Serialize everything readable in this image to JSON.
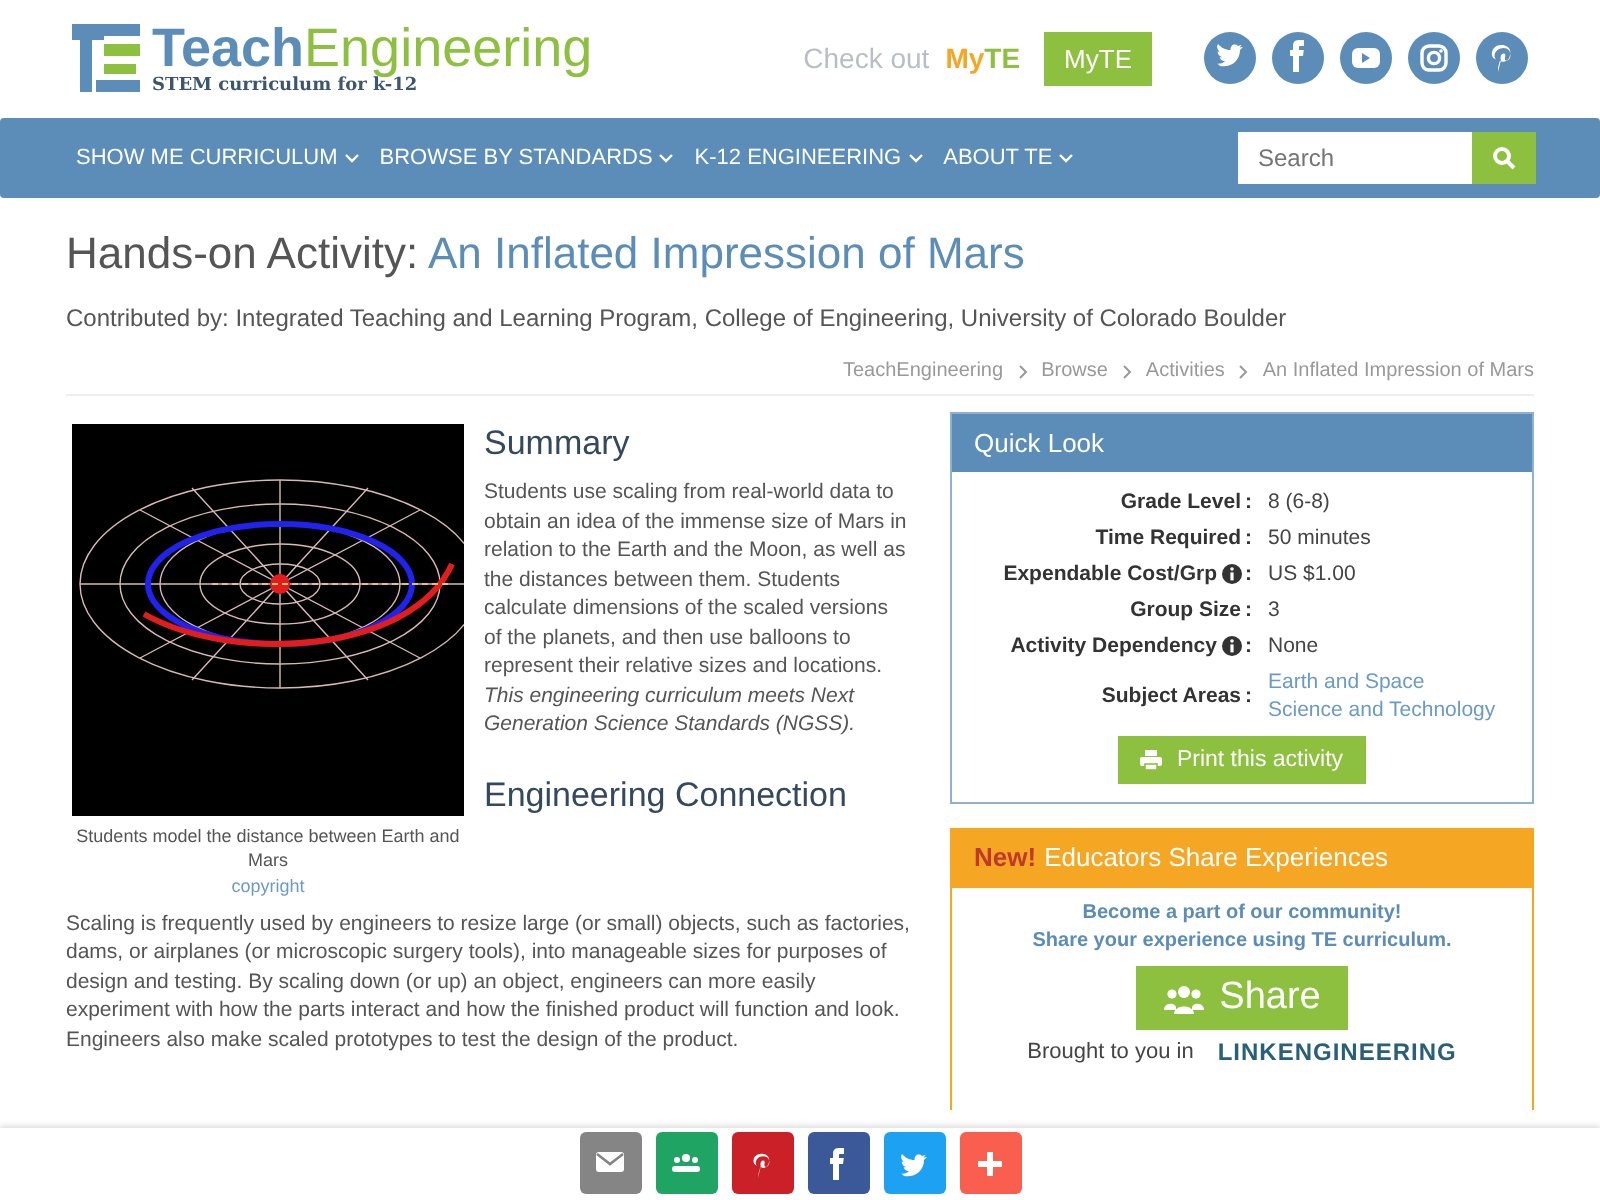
{
  "header": {
    "logo_primary": "Teach",
    "logo_secondary": "Engineering",
    "tagline": "STEM curriculum for k-12",
    "promo": "Check out",
    "promo_brand_1": "My",
    "promo_brand_2": "TE",
    "myte_button": "MyTE"
  },
  "nav": {
    "items": [
      {
        "label": "SHOW ME CURRICULUM"
      },
      {
        "label": "BROWSE BY STANDARDS"
      },
      {
        "label": "K-12 ENGINEERING"
      },
      {
        "label": "ABOUT TE"
      }
    ],
    "search": {
      "placeholder": "Search"
    }
  },
  "page": {
    "kind_label": "Hands-on Activity:",
    "title": "An Inflated Impression of Mars",
    "contributed": "Contributed by: Integrated Teaching and Learning Program, College of Engineering, University of Colorado Boulder",
    "breadcrumb": [
      "TeachEngineering",
      "Browse",
      "Activities",
      "An Inflated Impression of Mars"
    ]
  },
  "figure": {
    "caption": "Students model the distance between Earth and Mars",
    "credit": "copyright"
  },
  "summary": {
    "heading": "Summary",
    "text": "Students use scaling from real-world data to obtain an idea of the immense size of Mars in relation to the Earth and the Moon, as well as the distances between them. Students calculate dimensions of the scaled versions of the planets, and then use balloons to represent their relative sizes and locations.",
    "ngss": "This engineering curriculum meets Next Generation Science Standards (NGSS)."
  },
  "engineering": {
    "heading": "Engineering Connection",
    "text": "Scaling is frequently used by engineers to resize large (or small) objects, such as factories, dams, or airplanes (or microscopic surgery tools), into manageable sizes for purposes of design and testing. By scaling down (or up) an object, engineers can more easily experiment with how the parts interact and how the finished product will function and look. Engineers also make scaled prototypes to test the design of the product."
  },
  "quick_look": {
    "title": "Quick Look",
    "rows": [
      {
        "label": "Grade Level",
        "info": false,
        "colon": ":",
        "kind": "text",
        "values": [
          "8 (6-8)"
        ]
      },
      {
        "label": "Time Required",
        "info": false,
        "colon": ":",
        "kind": "text",
        "values": [
          "50 minutes"
        ]
      },
      {
        "label": "Expendable Cost/Grp",
        "info": true,
        "colon": ":",
        "kind": "text",
        "values": [
          "US $1.00"
        ]
      },
      {
        "label": "Group Size",
        "info": false,
        "colon": ":",
        "kind": "text",
        "values": [
          "3"
        ]
      },
      {
        "label": "Activity Dependency",
        "info": true,
        "colon": ":",
        "kind": "text",
        "values": [
          "None"
        ]
      },
      {
        "label": "Subject Areas",
        "info": false,
        "colon": ":",
        "kind": "link",
        "values": [
          "Earth and Space",
          "Science and Technology"
        ]
      }
    ],
    "print_button": "Print this activity"
  },
  "share_box": {
    "badge": "New!",
    "title": "Educators Share Experiences",
    "lines": [
      "Become a part of our community!",
      "Share your experience using TE curriculum."
    ],
    "button": "Share",
    "brought": "Brought to you in",
    "partner": "LINKENGINEERING"
  }
}
